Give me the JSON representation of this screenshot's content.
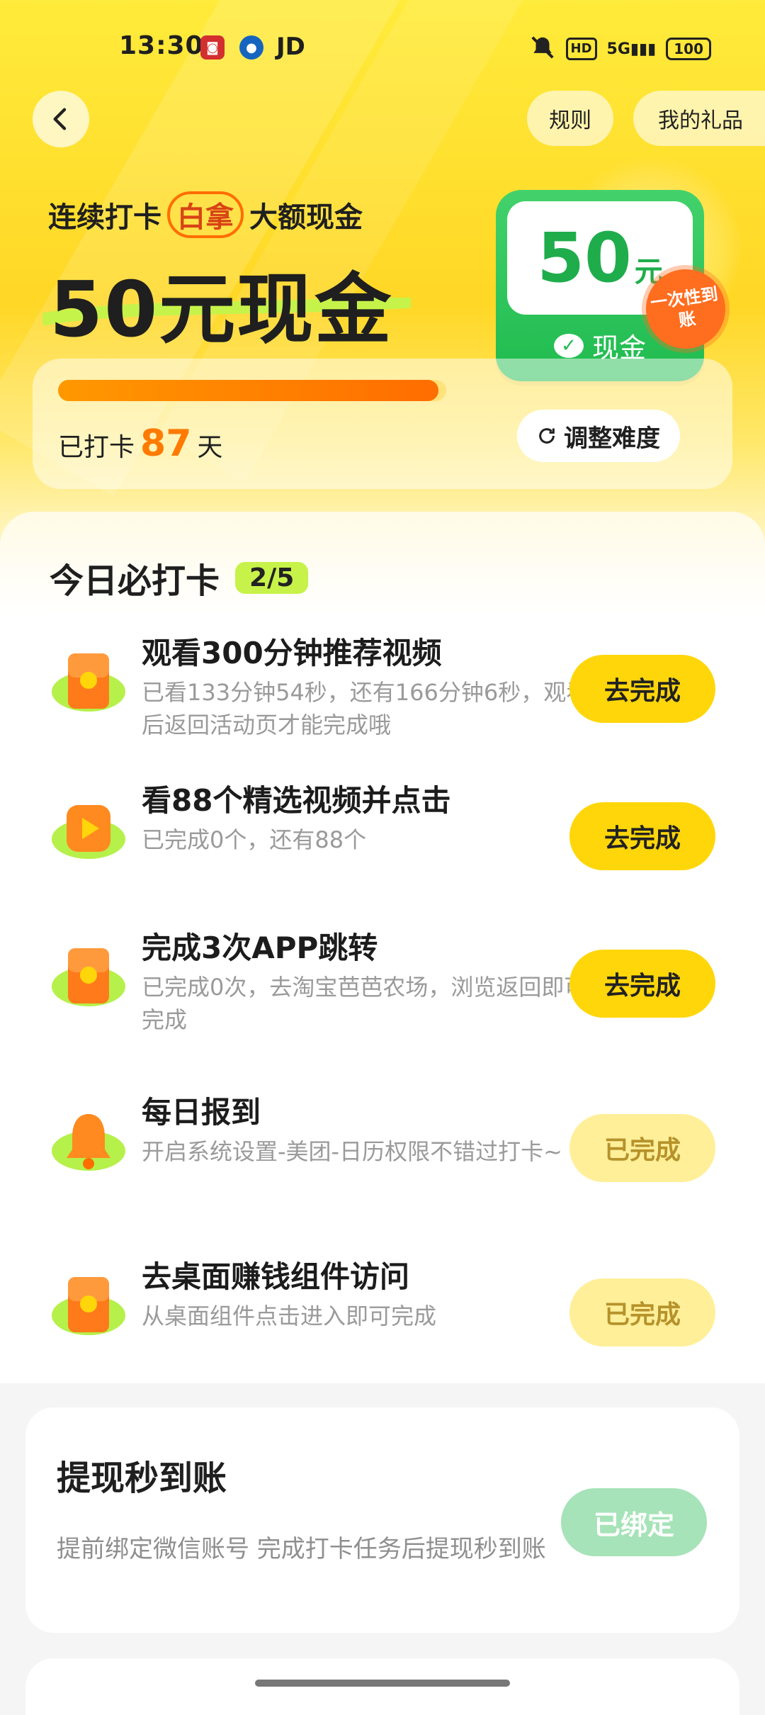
{
  "status_bar": {
    "time": "13:30",
    "app_icons": [
      "notification-red-icon",
      "notification-blue-icon"
    ],
    "carrier_text": "JD",
    "hd": "HD",
    "signal": "5G",
    "battery": "100"
  },
  "header": {
    "rules_label": "规则",
    "gifts_label": "我的礼品"
  },
  "hero": {
    "subtitle_before": "连续打卡",
    "subtitle_highlight": "白拿",
    "subtitle_after": "大额现金",
    "title": "50元现金",
    "reward_amount": "50",
    "reward_unit": "元",
    "reward_type": "现金",
    "one_time_badge": "一次性到账"
  },
  "progress": {
    "prefix": "已打卡",
    "days": "87",
    "suffix": "天",
    "fill_fraction": 0.98,
    "adjust_label": "调整难度"
  },
  "tasks_section": {
    "title": "今日必打卡",
    "count": "2/5",
    "tasks": [
      {
        "title": "观看300分钟推荐视频",
        "desc": "已看133分钟54秒，还有166分钟6秒，观看后返回活动页才能完成哦",
        "button": "去完成",
        "state": "todo",
        "icon": "red-envelope-icon"
      },
      {
        "title": "看88个精选视频并点击",
        "desc": "已完成0个，还有88个",
        "button": "去完成",
        "state": "todo",
        "icon": "play-video-icon"
      },
      {
        "title": "完成3次APP跳转",
        "desc": "已完成0次，去淘宝芭芭农场，浏览返回即可完成",
        "button": "去完成",
        "state": "todo",
        "icon": "red-envelope-icon"
      },
      {
        "title": "每日报到",
        "desc": "开启系统设置-美团-日历权限不错过打卡~",
        "button": "已完成",
        "state": "done",
        "icon": "bell-icon"
      },
      {
        "title": "去桌面赚钱组件访问",
        "desc": "从桌面组件点击进入即可完成",
        "button": "已完成",
        "state": "done",
        "icon": "red-envelope-icon"
      }
    ]
  },
  "withdraw": {
    "title": "提现秒到账",
    "desc": "提前绑定微信账号 完成打卡任务后提现秒到账",
    "button": "已绑定"
  },
  "colors": {
    "accent_yellow": "#ffd60a",
    "accent_green": "#1fbb4f",
    "accent_orange": "#ff7a00"
  }
}
